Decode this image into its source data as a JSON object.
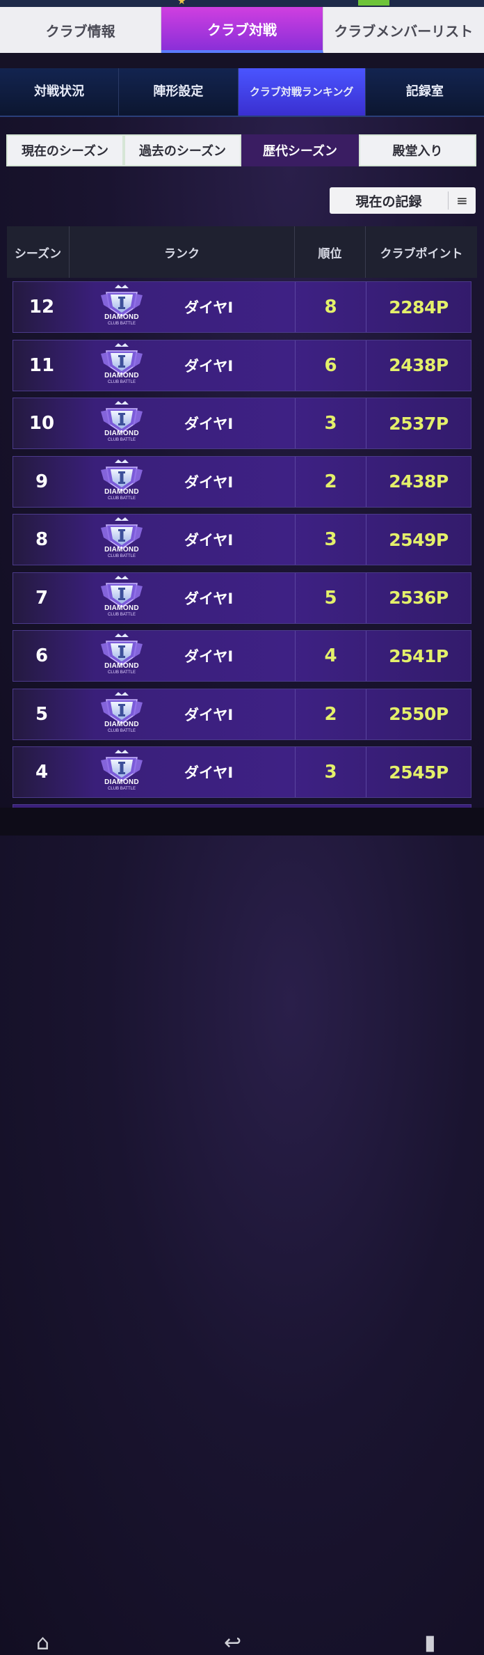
{
  "main_tabs": [
    {
      "label": "クラブ情報",
      "active": false
    },
    {
      "label": "クラブ対戦",
      "active": true
    },
    {
      "label": "クラブメンバーリスト",
      "active": false
    }
  ],
  "sub_tabs": [
    {
      "label": "対戦状況",
      "active": false
    },
    {
      "label": "陣形設定",
      "active": false
    },
    {
      "label": "クラブ対戦ランキング",
      "active": true
    },
    {
      "label": "記録室",
      "active": false
    }
  ],
  "season_tabs": [
    {
      "label": "現在のシーズン",
      "active": false
    },
    {
      "label": "過去のシーズン",
      "active": false
    },
    {
      "label": "歴代シーズン",
      "active": true
    },
    {
      "label": "殿堂入り",
      "active": false
    }
  ],
  "record_select": {
    "label": "現在の記録",
    "menu_icon": "≡"
  },
  "table": {
    "headers": {
      "season": "シーズン",
      "rank": "ランク",
      "position": "順位",
      "points": "クラブポイント"
    },
    "badge_text": "DIAMOND",
    "badge_subtext": "CLUB BATTLE",
    "rows": [
      {
        "season": "12",
        "rank": "ダイヤI",
        "position": "8",
        "points": "2284P"
      },
      {
        "season": "11",
        "rank": "ダイヤI",
        "position": "6",
        "points": "2438P"
      },
      {
        "season": "10",
        "rank": "ダイヤI",
        "position": "3",
        "points": "2537P"
      },
      {
        "season": "9",
        "rank": "ダイヤI",
        "position": "2",
        "points": "2438P"
      },
      {
        "season": "8",
        "rank": "ダイヤI",
        "position": "3",
        "points": "2549P"
      },
      {
        "season": "7",
        "rank": "ダイヤI",
        "position": "5",
        "points": "2536P"
      },
      {
        "season": "6",
        "rank": "ダイヤI",
        "position": "4",
        "points": "2541P"
      },
      {
        "season": "5",
        "rank": "ダイヤI",
        "position": "2",
        "points": "2550P"
      },
      {
        "season": "4",
        "rank": "ダイヤI",
        "position": "3",
        "points": "2545P"
      }
    ]
  },
  "colors": {
    "accent": "#e4f06a",
    "active_tab": "#8a2fd8",
    "row_bg": "#3e2184"
  }
}
